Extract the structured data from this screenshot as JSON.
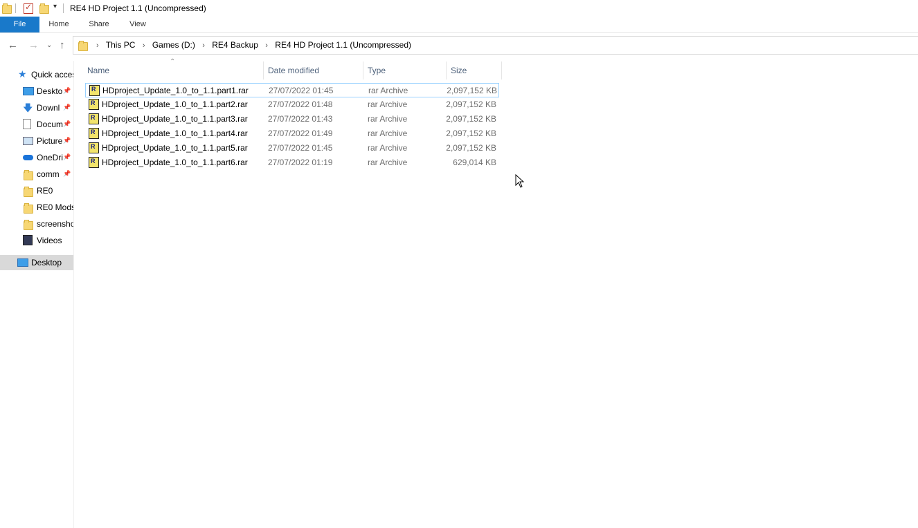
{
  "window": {
    "title": "RE4 HD Project 1.1 (Uncompressed)"
  },
  "ribbon": {
    "tabs": [
      "File",
      "Home",
      "Share",
      "View"
    ]
  },
  "address": {
    "crumbs": [
      "This PC",
      "Games (D:)",
      "RE4 Backup",
      "RE4 HD Project 1.1 (Uncompressed)"
    ]
  },
  "sidebar": {
    "items": [
      {
        "label": "Quick acces",
        "icon": "star-icon",
        "pinned": false
      },
      {
        "label": "Deskto",
        "icon": "desktop-icon",
        "pinned": true
      },
      {
        "label": "Downl",
        "icon": "download-icon",
        "pinned": true
      },
      {
        "label": "Docum",
        "icon": "document-icon",
        "pinned": true
      },
      {
        "label": "Picture",
        "icon": "pictures-icon",
        "pinned": true
      },
      {
        "label": "OneDri",
        "icon": "onedrive-icon",
        "pinned": true
      },
      {
        "label": "comm",
        "icon": "folder-icon",
        "pinned": true
      },
      {
        "label": "RE0",
        "icon": "folder-icon",
        "pinned": false
      },
      {
        "label": "RE0 Mods",
        "icon": "folder-icon",
        "pinned": false
      },
      {
        "label": "screensho",
        "icon": "folder-icon",
        "pinned": false
      },
      {
        "label": "Videos",
        "icon": "videos-icon",
        "pinned": false
      },
      {
        "label": "Desktop",
        "icon": "desktop-icon",
        "pinned": false
      }
    ]
  },
  "columns": {
    "name": "Name",
    "date": "Date modified",
    "type": "Type",
    "size": "Size"
  },
  "files": [
    {
      "name": "HDproject_Update_1.0_to_1.1.part1.rar",
      "date": "27/07/2022 01:45",
      "type": "rar Archive",
      "size": "2,097,152 KB"
    },
    {
      "name": "HDproject_Update_1.0_to_1.1.part2.rar",
      "date": "27/07/2022 01:48",
      "type": "rar Archive",
      "size": "2,097,152 KB"
    },
    {
      "name": "HDproject_Update_1.0_to_1.1.part3.rar",
      "date": "27/07/2022 01:43",
      "type": "rar Archive",
      "size": "2,097,152 KB"
    },
    {
      "name": "HDproject_Update_1.0_to_1.1.part4.rar",
      "date": "27/07/2022 01:49",
      "type": "rar Archive",
      "size": "2,097,152 KB"
    },
    {
      "name": "HDproject_Update_1.0_to_1.1.part5.rar",
      "date": "27/07/2022 01:45",
      "type": "rar Archive",
      "size": "2,097,152 KB"
    },
    {
      "name": "HDproject_Update_1.0_to_1.1.part6.rar",
      "date": "27/07/2022 01:19",
      "type": "rar Archive",
      "size": "629,014 KB"
    }
  ],
  "colors": {
    "file_tab": "#1979ca",
    "header_text": "#4c607a",
    "selection_border": "#99d1ff"
  }
}
